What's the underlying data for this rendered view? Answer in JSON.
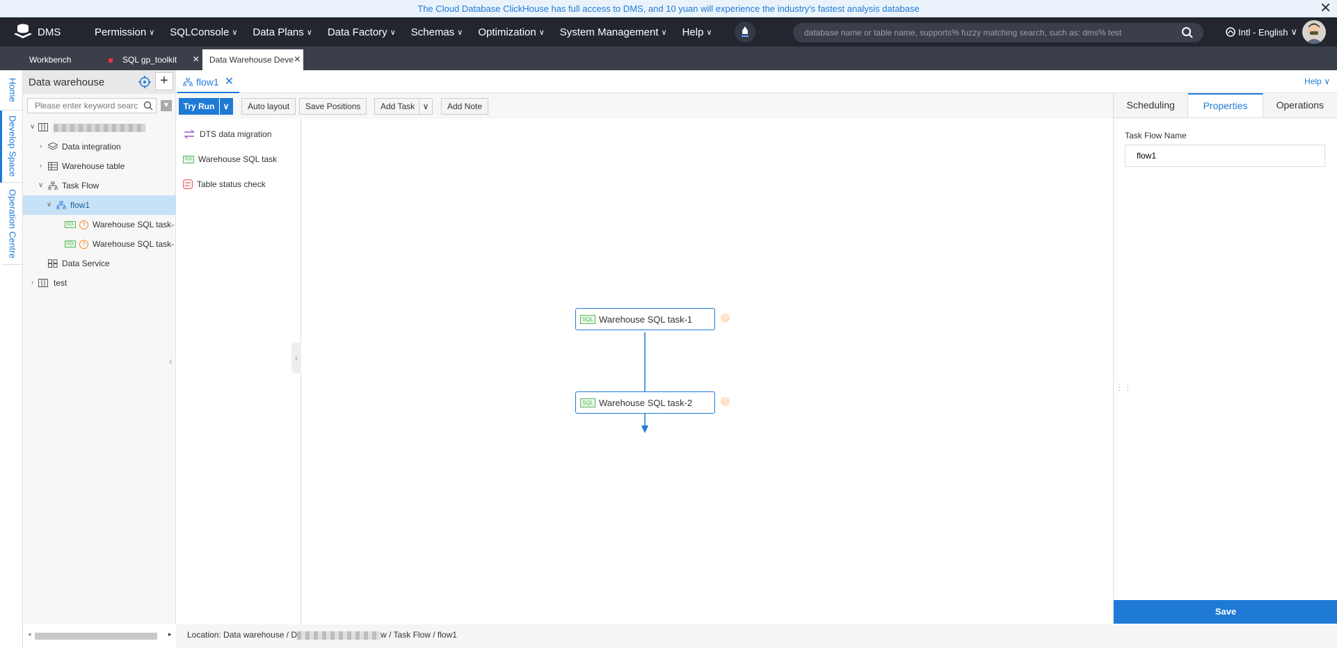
{
  "banner": {
    "text": "The Cloud Database ClickHouse has full access to DMS, and 10 yuan will experience the industry's fastest analysis database"
  },
  "nav": {
    "logo": "DMS",
    "items": [
      "Permission",
      "SQLConsole",
      "Data Plans",
      "Data Factory",
      "Schemas",
      "Optimization",
      "System Management",
      "Help"
    ],
    "search_placeholder": "database name or table name, supports% fuzzy matching search, such as: dms% test",
    "language": "Intl - English"
  },
  "tabs": [
    {
      "label": "Workbench"
    },
    {
      "label": "SQL gp_toolkit"
    },
    {
      "label": "Data Warehouse Deve"
    }
  ],
  "vtabs": [
    "Home",
    "Develop Space",
    "Operation Centre"
  ],
  "left": {
    "title": "Data warehouse",
    "search_placeholder": "Please enter keyword searc",
    "tree": {
      "data_integration": "Data integration",
      "warehouse_table": "Warehouse table",
      "task_flow": "Task Flow",
      "flow1": "flow1",
      "task1": "Warehouse SQL task-",
      "task2": "Warehouse SQL task-",
      "data_service": "Data Service",
      "test": "test"
    }
  },
  "flowtab": {
    "label": "flow1",
    "help": "Help"
  },
  "toolbar": {
    "try_run": "Try Run",
    "auto_layout": "Auto layout",
    "save_positions": "Save Positions",
    "add_task": "Add Task",
    "add_note": "Add Note"
  },
  "palette": {
    "dts": "DTS data migration",
    "sql_task": "Warehouse SQL task",
    "status_check": "Table status check",
    "sql_tag": "SQL"
  },
  "canvas": {
    "node1": "Warehouse SQL task-1",
    "node2": "Warehouse SQL task-2",
    "qmark": "?"
  },
  "right": {
    "tabs": [
      "Scheduling",
      "Properties",
      "Operations"
    ],
    "field_label": "Task Flow Name",
    "field_value": "flow1",
    "save": "Save"
  },
  "status": {
    "prefix": "Location:",
    "part1": "Data warehouse / D",
    "part2": "w / Task Flow / flow1"
  },
  "colors": {
    "accent": "#1f7ad6",
    "nav_bg": "#23262e",
    "tab_bg": "#3b3f4a"
  }
}
